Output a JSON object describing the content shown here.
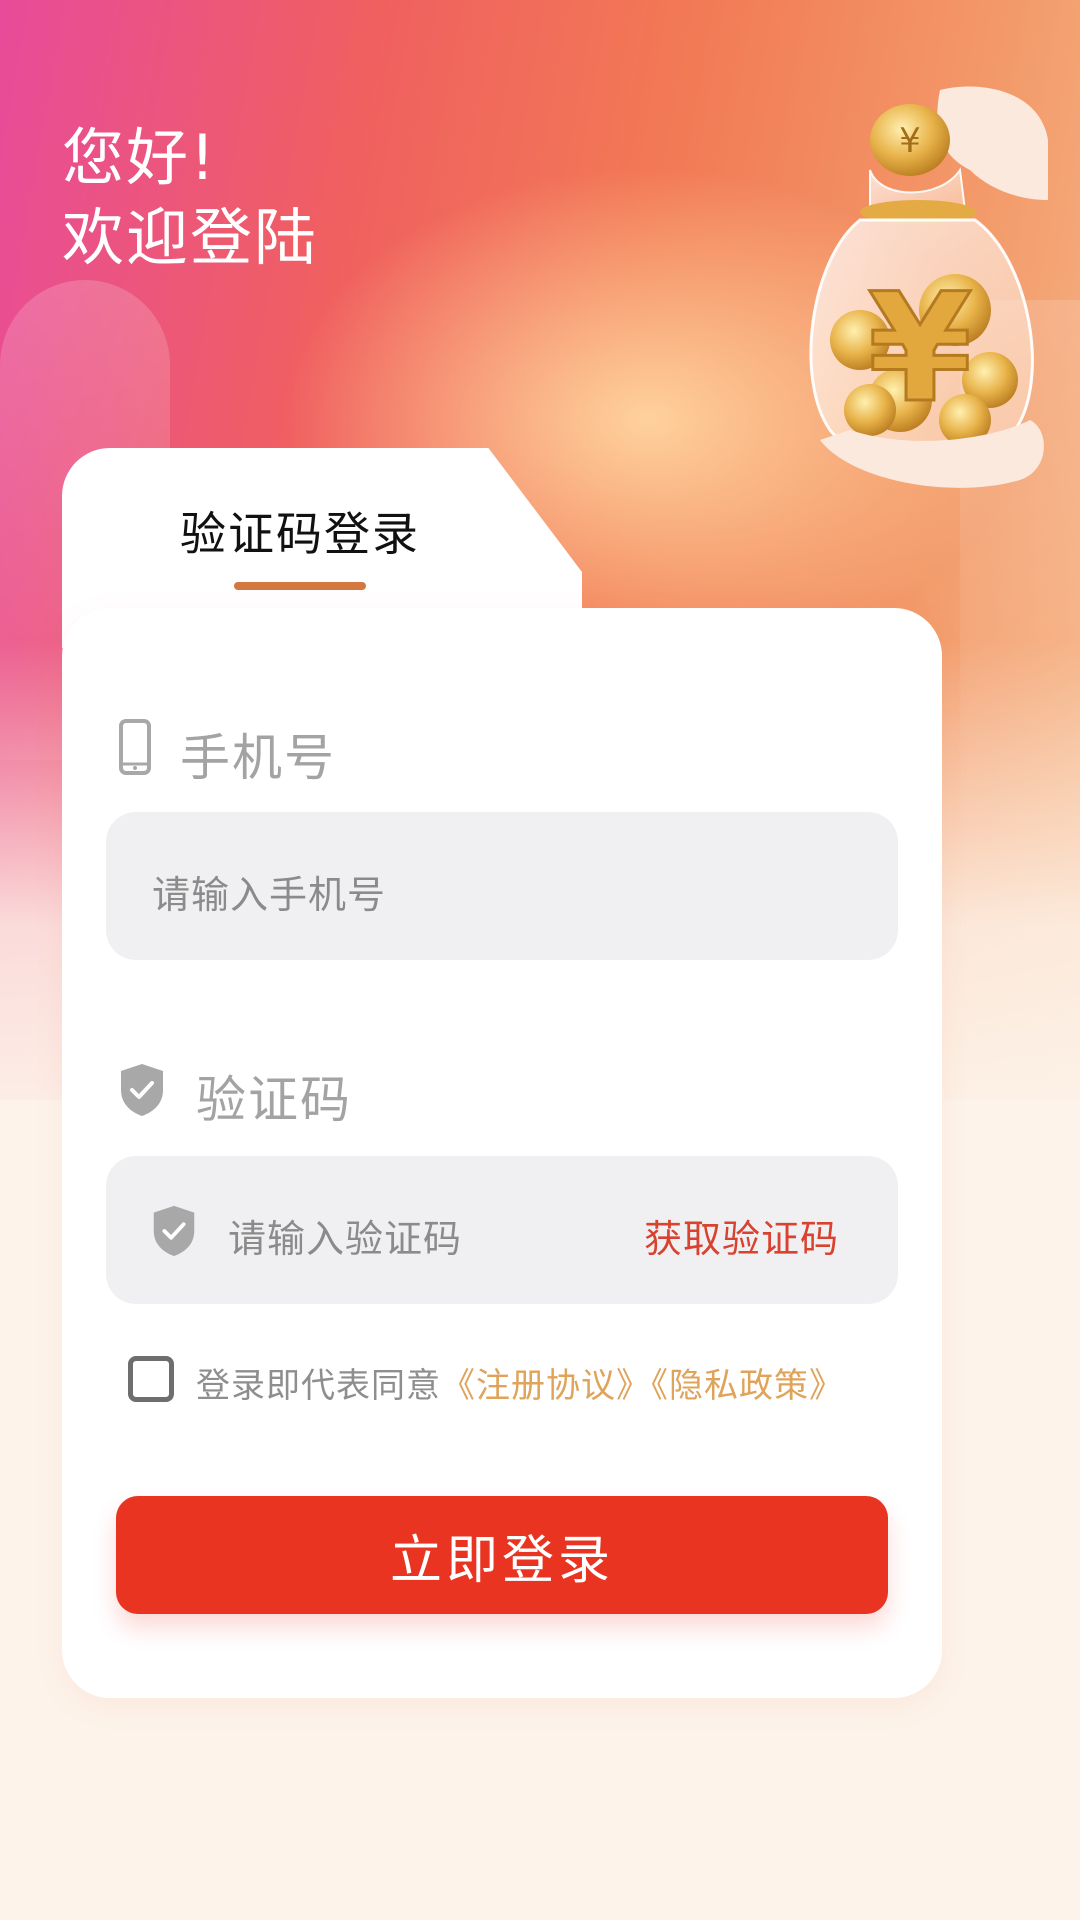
{
  "greeting": {
    "line1": "您好!",
    "line2": "欢迎登陆"
  },
  "tabs": {
    "active_label": "验证码登录"
  },
  "phone": {
    "label": "手机号",
    "placeholder": "请输入手机号",
    "icon": "phone-icon"
  },
  "code": {
    "label": "验证码",
    "placeholder": "请输入验证码",
    "get_code_label": "获取验证码",
    "icon": "shield-check-icon"
  },
  "agreement": {
    "prefix": "登录即代表同意",
    "register_link": "《注册协议》",
    "privacy_link": "《隐私政策》",
    "checked": false
  },
  "login_button": {
    "label": "立即登录"
  },
  "colors": {
    "accent": "#e83421",
    "tab_underline": "#d4783f",
    "link": "#e0a35a",
    "get_code": "#d8422f"
  }
}
